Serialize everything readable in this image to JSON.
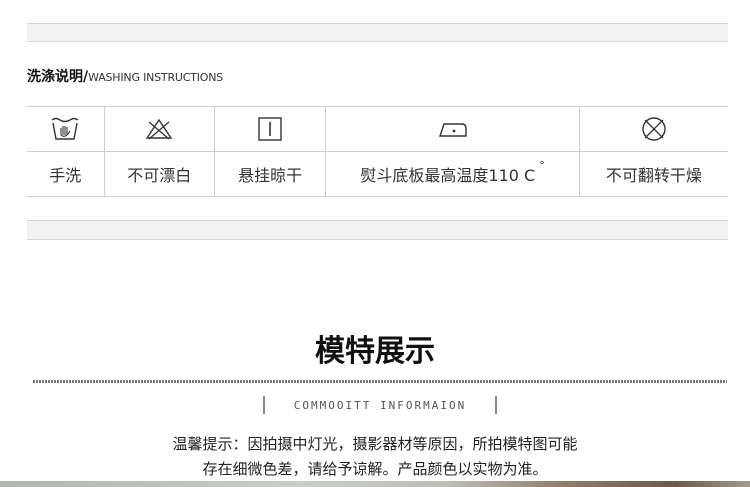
{
  "washing": {
    "title_cn": "洗涤说明/",
    "title_en": "WASHING INSTRUCTIONS",
    "items": [
      {
        "icon": "hand-wash-icon",
        "label": "手洗"
      },
      {
        "icon": "no-bleach-icon",
        "label": "不可漂白"
      },
      {
        "icon": "line-dry-icon",
        "label": "悬挂晾干"
      },
      {
        "icon": "iron-icon",
        "label": "熨斗底板最高温度110 C",
        "degree": "°"
      },
      {
        "icon": "no-tumble-dry-icon",
        "label": "不可翻转干燥"
      }
    ]
  },
  "model": {
    "title": "模特展示",
    "subtitle": "COMMOOITT INFORMAION",
    "notice_line1": "温馨提示：因拍摄中灯光，摄影器材等原因，所拍模特图可能",
    "notice_line2": "存在细微色差，请给予谅解。产品颜色以实物为准。"
  }
}
